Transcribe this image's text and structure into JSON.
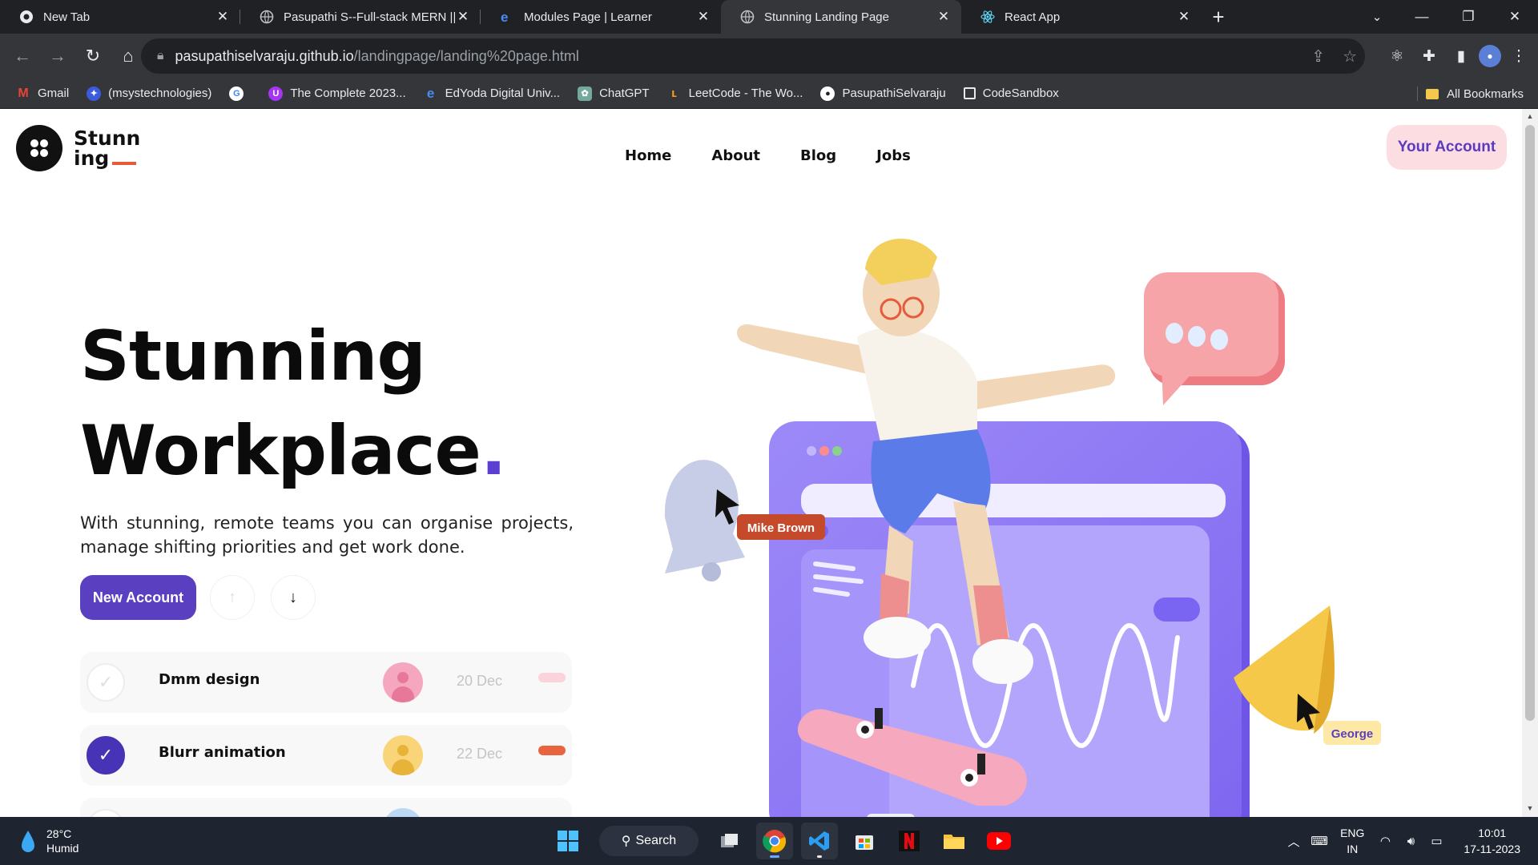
{
  "browser": {
    "tabs": [
      {
        "title": "New Tab",
        "active": false
      },
      {
        "title": "Pasupathi S--Full-stack MERN ||",
        "active": false
      },
      {
        "title": "Modules Page | Learner",
        "active": false
      },
      {
        "title": "Stunning Landing Page",
        "active": true
      },
      {
        "title": "React App",
        "active": false
      }
    ],
    "url_host": "pasupathiselvaraju.github.io",
    "url_path": "/landingpage/landing%20page.html",
    "bookmarks": [
      {
        "label": "Gmail",
        "icon": "gmail-icon",
        "color": "#ea4335"
      },
      {
        "label": "(msystechnologies)",
        "icon": "msys-icon",
        "color": "#3b5bdb"
      },
      {
        "label": "",
        "icon": "google-icon",
        "color": "#ffffff"
      },
      {
        "label": "The Complete 2023...",
        "icon": "udemy-icon",
        "color": "#a435f0"
      },
      {
        "label": "EdYoda Digital Univ...",
        "icon": "edyoda-icon",
        "color": "#1a73e8"
      },
      {
        "label": "ChatGPT",
        "icon": "chatgpt-icon",
        "color": "#74aa9c"
      },
      {
        "label": "LeetCode - The Wo...",
        "icon": "leetcode-icon",
        "color": "#ffa116"
      },
      {
        "label": "PasupathiSelvaraju",
        "icon": "github-icon",
        "color": "#ffffff"
      },
      {
        "label": "CodeSandbox",
        "icon": "codesandbox-icon",
        "color": "#ffffff"
      }
    ],
    "all_bookmarks": "All Bookmarks"
  },
  "site": {
    "logo_line1": "Stunn",
    "logo_line2": "ing",
    "nav": [
      "Home",
      "About",
      "Blog",
      "Jobs"
    ],
    "account_button": "Your Account",
    "hero_line1": "Stunning",
    "hero_line2": "Workplace",
    "hero_dot": ".",
    "description": "With stunning, remote teams you can organise projects, manage shifting priorities and get work done.",
    "new_account_button": "New Account",
    "tasks": [
      {
        "name": "Dmm design",
        "date": "20 Dec",
        "done": false,
        "avatar_color": "#f4a7be",
        "pill_color": "#fbd3da"
      },
      {
        "name": "Blurr animation",
        "date": "22 Dec",
        "done": true,
        "avatar_color": "#f9d479",
        "pill_color": "#e8643f"
      }
    ],
    "illustration_labels": {
      "left": "Mike Brown",
      "right": "George"
    },
    "colors": {
      "accent": "#5a3fc0",
      "orange": "#e55b3c",
      "pink": "#fbdde2"
    }
  },
  "taskbar": {
    "temperature": "28°C",
    "weather": "Humid",
    "search": "Search",
    "lang1": "ENG",
    "lang2": "IN",
    "time": "10:01",
    "date": "17-11-2023"
  }
}
